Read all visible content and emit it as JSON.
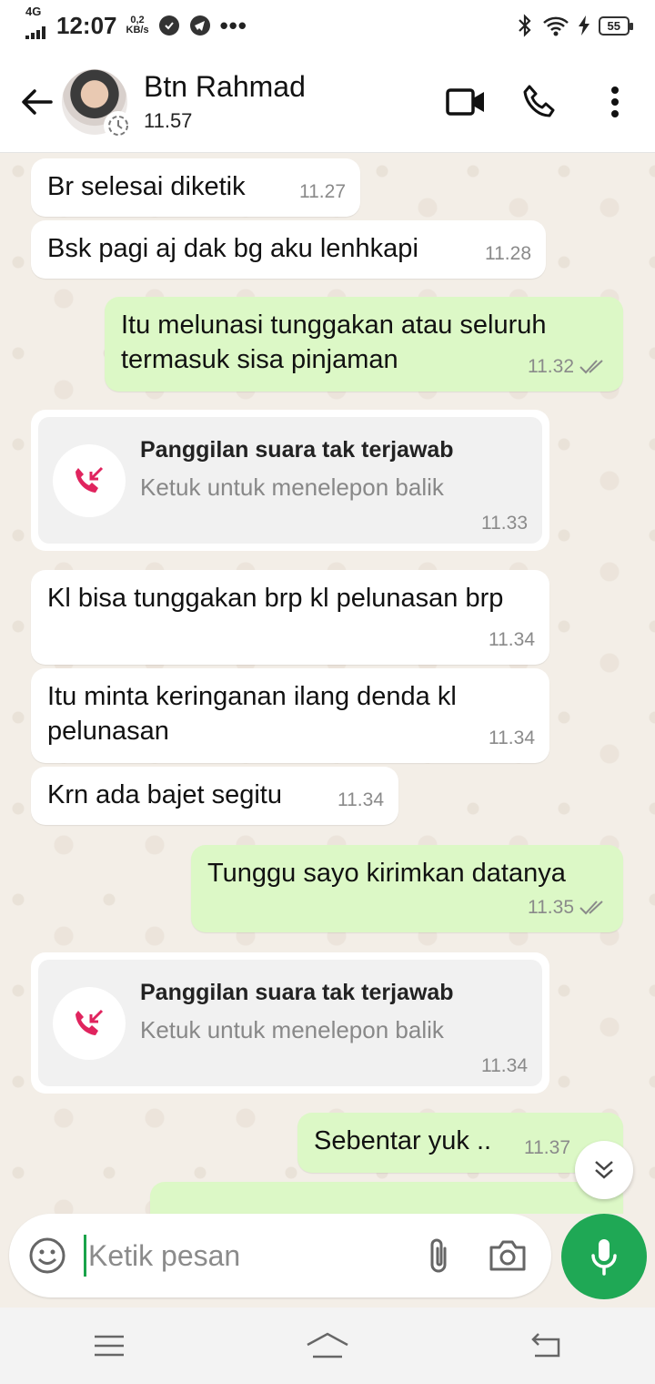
{
  "status_bar": {
    "network": "4G",
    "time": "12:07",
    "speed_value": "0,2",
    "speed_unit": "KB/s",
    "more": "•••",
    "battery": "55"
  },
  "header": {
    "contact_name": "Btn Rahmad",
    "last_seen": "11.57"
  },
  "messages": [
    {
      "dir": "in",
      "text": "Br selesai diketik",
      "time": "11.27"
    },
    {
      "dir": "in",
      "text": "Bsk pagi aj dak bg aku lenhkapi",
      "time": "11.28"
    },
    {
      "dir": "out",
      "text": "Itu melunasi tunggakan atau seluruh termasuk sisa pinjaman",
      "time": "11.32"
    },
    {
      "dir": "call",
      "title": "Panggilan suara tak terjawab",
      "subtitle": "Ketuk untuk menelepon balik",
      "time": "11.33"
    },
    {
      "dir": "in",
      "text": "Kl bisa tunggakan brp kl pelunasan brp",
      "time": "11.34"
    },
    {
      "dir": "in",
      "text": "Itu minta keringanan ilang denda kl pelunasan",
      "time": "11.34"
    },
    {
      "dir": "in",
      "text": "Krn ada bajet segitu",
      "time": "11.34"
    },
    {
      "dir": "out",
      "text": "Tunggu sayo kirimkan datanya",
      "time": "11.35"
    },
    {
      "dir": "call",
      "title": "Panggilan suara tak terjawab",
      "subtitle": "Ketuk untuk menelepon balik",
      "time": "11.34"
    },
    {
      "dir": "out",
      "text": "Sebentar yuk ..",
      "time": "11.37"
    }
  ],
  "composer": {
    "placeholder": "Ketik pesan"
  },
  "colors": {
    "accent": "#1fa855",
    "out_bubble": "#dcf8c6",
    "in_bubble": "#ffffff",
    "missed_call": "#e0245e",
    "ticks": "#8a8a8a"
  },
  "icons": [
    "back-arrow-icon",
    "video-call-icon",
    "voice-call-icon",
    "more-options-icon",
    "emoji-icon",
    "attach-icon",
    "camera-icon",
    "mic-icon",
    "missed-call-icon",
    "scroll-down-icon"
  ]
}
